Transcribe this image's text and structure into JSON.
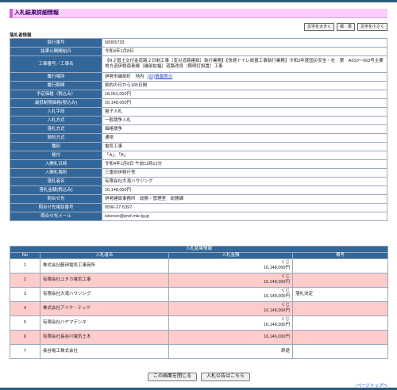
{
  "page_title": "入札結果詳細情報",
  "font_buttons": {
    "large": "文字を大きく",
    "standard": "標　準",
    "small": "文字を小さく"
  },
  "section_label": "落札者情報",
  "detail": [
    {
      "label": "執行番号",
      "value": "58305733"
    },
    {
      "label": "結果公開開始日",
      "value": "令和4年1月8日"
    },
    {
      "label": "工事番号／工事名",
      "value": "【R２国土交付金道路２日制工事（変災道路建設）執行業務】【快適トイレ設置工事執行業務】令和3年度国災安全・社　第　A010～063号主要地方道伊勢南島線（磯部拡幅）道路改良（照明灯設置）工事"
    },
    {
      "label": "履行場所",
      "value": "伊勢市磯部町　地内",
      "link": "(20)情報表示"
    },
    {
      "label": "履行期間",
      "value": "契約の日から165日間"
    },
    {
      "label": "予定価格（税込み）",
      "value": "18,051,000円"
    },
    {
      "label": "最低制限価格(税込み)",
      "value": "16,148,000円"
    },
    {
      "label": "入札手段",
      "value": "電子入札"
    },
    {
      "label": "入札方式",
      "value": "一般競争入札"
    },
    {
      "label": "落札方式",
      "value": "価格競争"
    },
    {
      "label": "契約方式",
      "value": "通常"
    },
    {
      "label": "種別",
      "value": "電気工事"
    },
    {
      "label": "格付",
      "value": "「A」、「B」"
    },
    {
      "label": "入開札日時",
      "value": "令和4年1月8日 午前11時12分"
    },
    {
      "label": "入開札場所",
      "value": "三重県伊勢庁舎"
    },
    {
      "label": "落札者名",
      "value": "有限会社大滝ハウジング"
    },
    {
      "label": "落札金額(税込み)",
      "value": "16,148,000円"
    },
    {
      "label": "問合せ先",
      "value": "伊勢建設事務所　総務・管理室　総務課"
    },
    {
      "label": "問合せ先電話番号",
      "value": "0596-27-5397"
    },
    {
      "label": "問合せ先メール",
      "value": "iskensn@pref.mie.lg.jp"
    }
  ],
  "results": {
    "title": "入札結果情報",
    "columns": {
      "no": "No",
      "name": "入札者名",
      "amount": "入札金額",
      "note": "備考"
    },
    "rows": [
      {
        "no": "1",
        "name": "株式会社藤田電気工事商所",
        "lot": "くじ",
        "amount": "16,148,000円",
        "note": ""
      },
      {
        "no": "2",
        "name": "有限会社ユタカ電気工事",
        "lot": "くじ",
        "amount": "16,148,000円",
        "note": ""
      },
      {
        "no": "3",
        "name": "有限会社大滝ハウジング",
        "lot": "くじ",
        "amount": "16,148,000円",
        "note": "落札決定"
      },
      {
        "no": "4",
        "name": "株式会社アイク・テック",
        "lot": "くじ",
        "amount": "16,148,000円",
        "note": ""
      },
      {
        "no": "5",
        "name": "有限会社ハヤマデンキ",
        "lot": "くじ",
        "amount": "16,148,000円",
        "note": ""
      },
      {
        "no": "6",
        "name": "有限会社長谷川電気土木",
        "lot": "",
        "amount": "16,146,000円",
        "note": ""
      },
      {
        "no": "7",
        "name": "長谷電工株式会社",
        "lot": "",
        "amount": "辞退",
        "note": ""
      }
    ]
  },
  "footer": {
    "close": "この画面を閉じる",
    "notice": "入札公告はこちら",
    "page_top": "↑ページトップへ"
  },
  "colors": {
    "header": "#336699",
    "title_bar": "#ffccff",
    "alt_row": "#ffcccc",
    "link": "#1a3fd0"
  }
}
